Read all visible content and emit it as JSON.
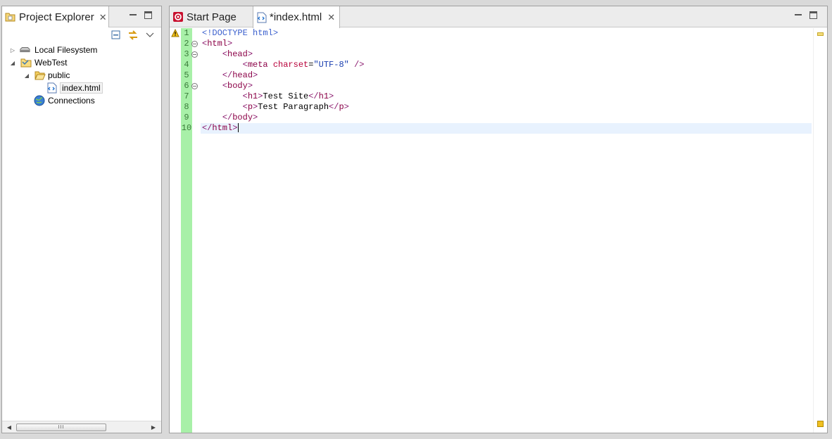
{
  "explorer": {
    "tab_title": "Project Explorer",
    "close_glyph": "✕",
    "tree": [
      {
        "label": "Local Filesystem",
        "icon": "drive-icon",
        "level": 0,
        "twisty": "collapsed"
      },
      {
        "label": "WebTest",
        "icon": "project-folder-icon",
        "level": 0,
        "twisty": "expanded"
      },
      {
        "label": "public",
        "icon": "folder-open-icon",
        "level": 1,
        "twisty": "expanded"
      },
      {
        "label": "index.html",
        "icon": "html-file-icon",
        "level": 2,
        "twisty": "none",
        "selected": true
      },
      {
        "label": "Connections",
        "icon": "globe-icon",
        "level": 1,
        "twisty": "none"
      }
    ],
    "scroll_thumb_glyph": "III"
  },
  "editor": {
    "tabs": [
      {
        "label": "Start Page",
        "icon": "start-page-icon",
        "active": false
      },
      {
        "label": "*index.html",
        "icon": "html-file-icon",
        "active": true
      }
    ],
    "close_glyph": "✕",
    "lines": [
      {
        "n": "1",
        "text": "<!DOCTYPE html>",
        "fold": false,
        "warning": true
      },
      {
        "n": "2",
        "text": "<html>",
        "fold": true
      },
      {
        "n": "3",
        "text": "    <head>",
        "fold": true
      },
      {
        "n": "4",
        "text": "        <meta charset=\"UTF-8\" />",
        "fold": false
      },
      {
        "n": "5",
        "text": "    </head>",
        "fold": false
      },
      {
        "n": "6",
        "text": "    <body>",
        "fold": true
      },
      {
        "n": "7",
        "text": "        <h1>Test Site</h1>",
        "fold": false
      },
      {
        "n": "8",
        "text": "        <p>Test Paragraph</p>",
        "fold": false
      },
      {
        "n": "9",
        "text": "    </body>",
        "fold": false
      },
      {
        "n": "10",
        "text": "</html>",
        "fold": false,
        "current": true
      }
    ]
  },
  "colors": {
    "line_number_bg": "#a8f0a8",
    "current_line_bg": "#e8f2fe",
    "tag_color": "#3a5fcd",
    "attr_color": "#b8003a",
    "value_color": "#1a3fb0"
  }
}
